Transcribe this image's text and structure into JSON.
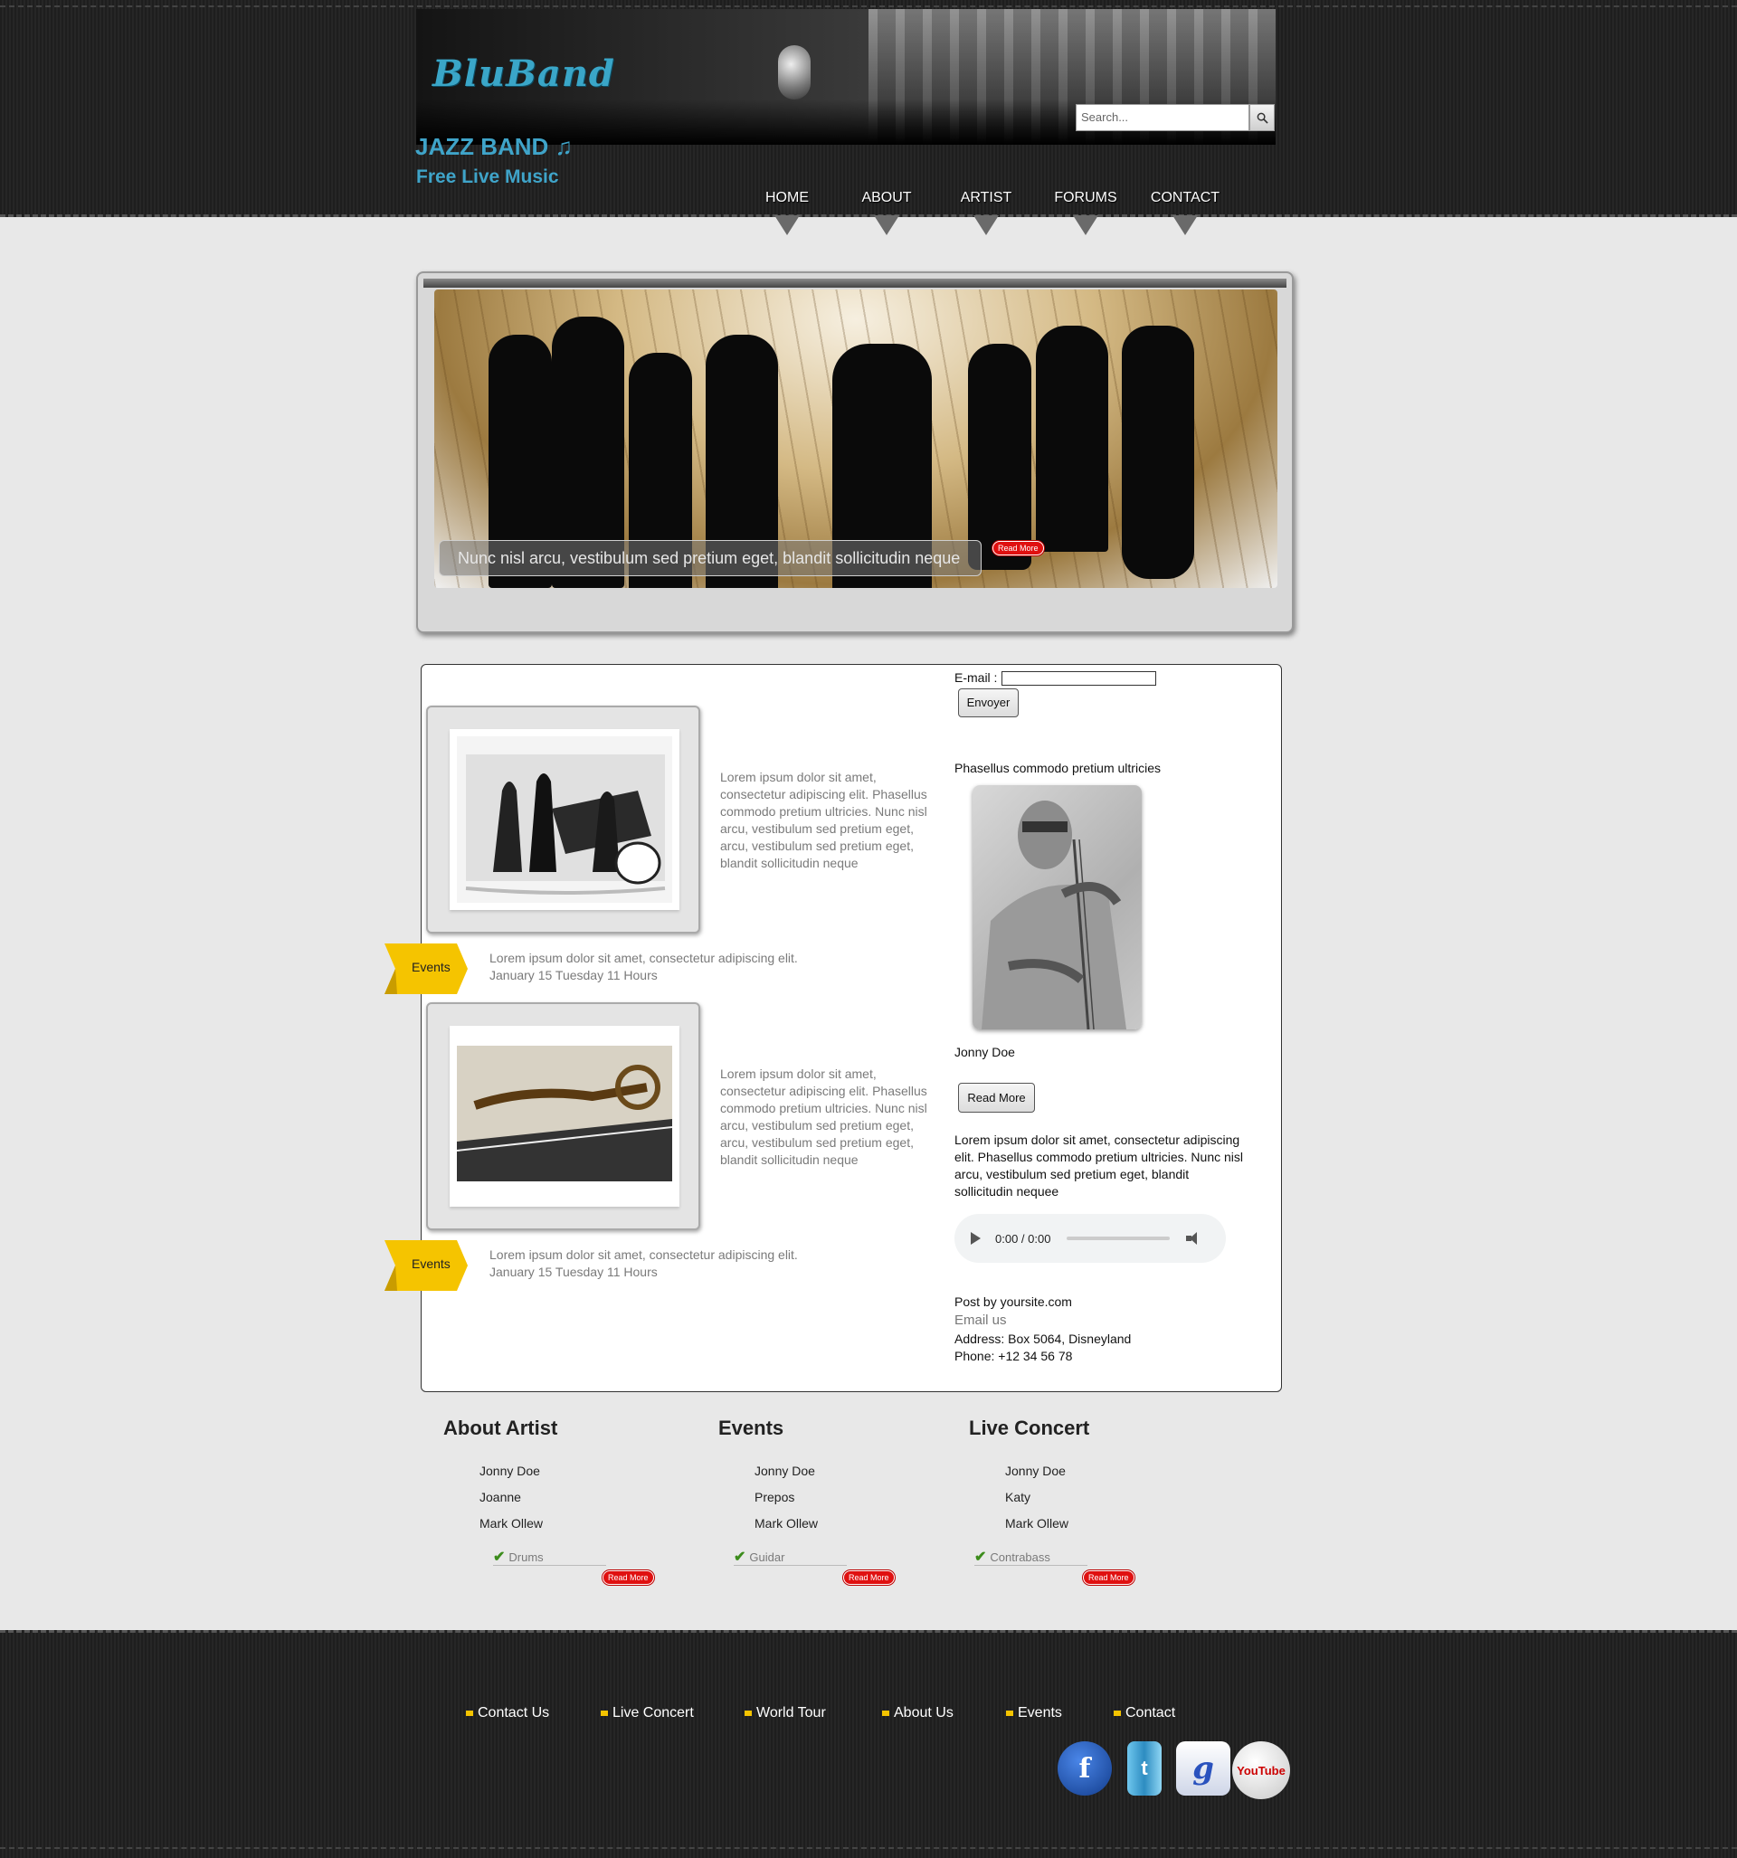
{
  "header": {
    "logo_text": "BluBand",
    "search_placeholder": "Search...",
    "tagline_main": "JAZZ BAND ♫",
    "tagline_sub": "Free Live Music",
    "nav": [
      "HOME",
      "ABOUT",
      "ARTIST",
      "FORUMS",
      "CONTACT"
    ]
  },
  "slider": {
    "caption": "Nunc nisl arcu, vestibulum sed pretium eget, blandit sollicitudin neque",
    "read_more": "Read More"
  },
  "main": {
    "posts": [
      {
        "text": "Lorem ipsum dolor sit amet, consectetur adipiscing elit. Phasellus commodo pretium ultricies. Nunc nisl arcu, vestibulum sed pretium eget, arcu, vestibulum sed pretium eget, blandit sollicitudin neque",
        "event_label": "Events",
        "event_text": "Lorem ipsum dolor sit amet, consectetur adipiscing elit.",
        "event_date": "January 15 Tuesday 11 Hours"
      },
      {
        "text": "Lorem ipsum dolor sit amet, consectetur adipiscing elit. Phasellus commodo pretium ultricies. Nunc nisl arcu, vestibulum sed pretium eget, arcu, vestibulum sed pretium eget, blandit sollicitudin neque",
        "event_label": "Events",
        "event_text": "Lorem ipsum dolor sit amet, consectetur adipiscing elit.",
        "event_date": "January 15 Tuesday 11 Hours"
      }
    ],
    "sidebar": {
      "email_label": "E-mail :",
      "email_value": "",
      "submit_label": "Envoyer",
      "heading": "Phasellus commodo pretium ultricies",
      "artist_name": "Jonny Doe",
      "read_more": "Read More",
      "paragraph": "Lorem ipsum dolor sit amet, consectetur adipiscing elit. Phasellus commodo pretium ultricies. Nunc nisl arcu, vestibulum sed pretium eget, blandit sollicitudin nequee",
      "audio_time": "0:00 / 0:00",
      "post_by": "Post by yoursite.com",
      "email_us": "Email us",
      "address": "Address: Box 5064, Disneyland",
      "phone": "Phone: +12 34 56 78"
    }
  },
  "columns": [
    {
      "title": "About Artist",
      "links": [
        "Jonny Doe",
        "Joanne",
        "Mark Ollew"
      ],
      "check": "Drums",
      "read_more": "Read More"
    },
    {
      "title": "Events",
      "links": [
        "Jonny Doe",
        "Prepos",
        "Mark Ollew"
      ],
      "check": "Guidar",
      "read_more": "Read More"
    },
    {
      "title": "Live Concert",
      "links": [
        "Jonny Doe",
        "Katy",
        "Mark Ollew"
      ],
      "check": "Contrabass",
      "read_more": "Read More"
    }
  ],
  "footer": {
    "links": [
      "Contact Us",
      "Live Concert",
      "World Tour",
      "About Us",
      "Events",
      "Contact"
    ],
    "social": [
      {
        "label": "f",
        "icon": "facebook-icon"
      },
      {
        "label": "t",
        "icon": "twitter-icon"
      },
      {
        "label": "g",
        "icon": "google-icon"
      },
      {
        "label": "YouTube",
        "icon": "youtube-icon"
      }
    ]
  },
  "colors": {
    "accent_blue": "#3fa4c9",
    "event_yellow": "#f5c400",
    "read_more_red": "#e01010",
    "dark_bg": "#222222"
  }
}
